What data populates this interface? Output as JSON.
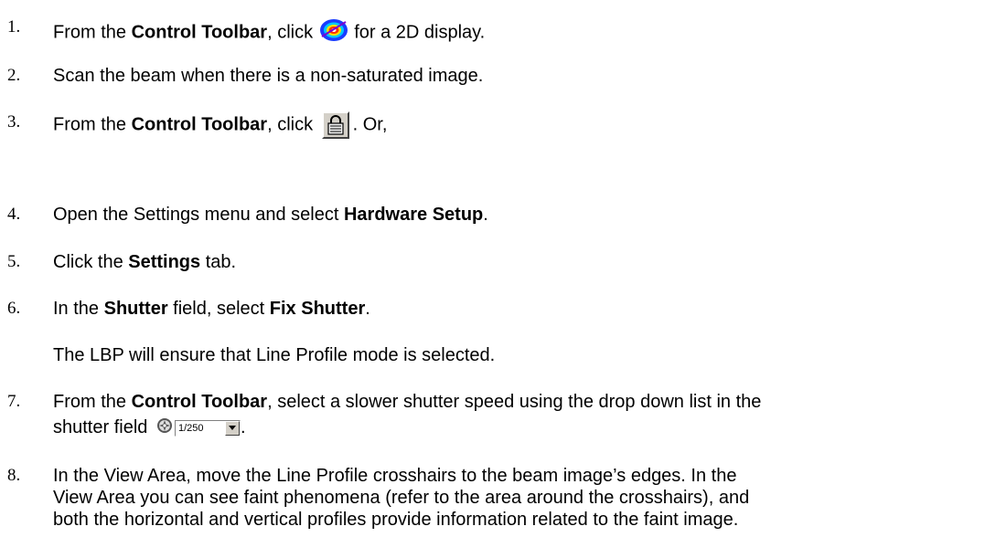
{
  "steps": [
    {
      "num": "1.",
      "pre": "From the ",
      "bold": "Control Toolbar",
      "post_a": ", click ",
      "icon": "2d-display-icon",
      "post_b": " for a 2D display."
    },
    {
      "num": "2.",
      "text": "Scan the beam when there is a non-saturated image."
    },
    {
      "num": "3.",
      "pre": "From the ",
      "bold": "Control Toolbar",
      "post_a": ", click ",
      "icon": "lock-icon",
      "post_b": ". Or,"
    },
    {
      "num": "4.",
      "pre": "Open the Settings menu and select ",
      "bold": "Hardware Setup",
      "post": "."
    },
    {
      "num": "5.",
      "pre": "Click the ",
      "bold": "Settings",
      "post": " tab."
    },
    {
      "num": "6.",
      "pre": "In the ",
      "bold": "Shutter",
      "mid": " field, select ",
      "bold2": "Fix Shutter",
      "post": "."
    },
    {
      "num": "7.",
      "pre": "From the ",
      "bold": "Control Toolbar",
      "post_a": ", select a slower shutter speed using the drop down list in the",
      "line2": "shutter field",
      "shutter_value": "1/250",
      "post_b": "."
    },
    {
      "num": "8.",
      "line1": "In the View Area, move the Line Profile crosshairs to the beam image’s edges. In the",
      "line2": "View Area you can see faint phenomena (refer to the area around the crosshairs), and",
      "line3": "both the horizontal and vertical profiles provide information related to the faint image."
    }
  ],
  "note_6": "The LBP will ensure that Line Profile mode is selected."
}
